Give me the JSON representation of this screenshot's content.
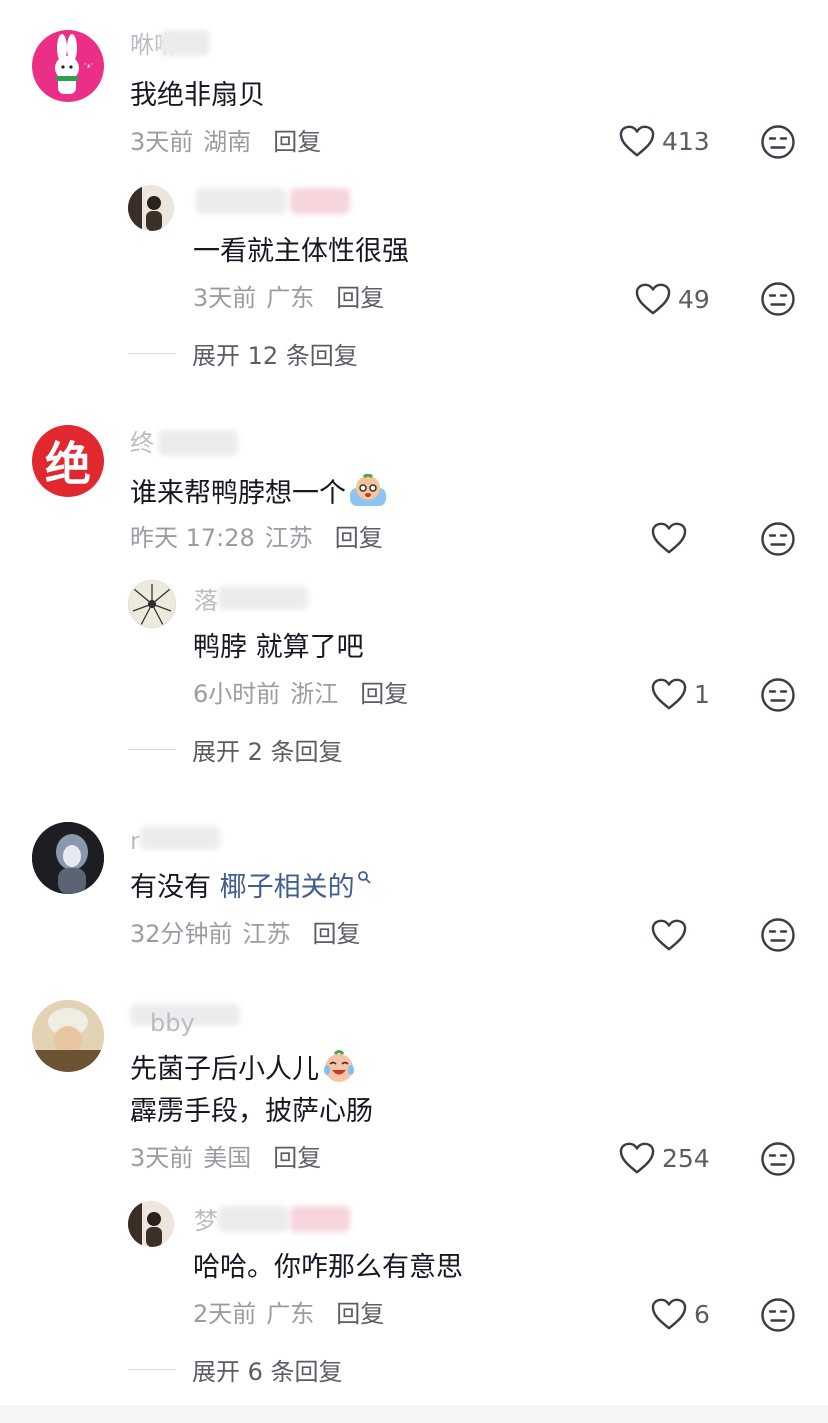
{
  "comments": [
    {
      "name": "咻咻",
      "text": "我绝非扇贝",
      "time": "3天前",
      "location": "湖南",
      "reply_label": "回复",
      "likes": "413",
      "replies": [
        {
          "name": "",
          "text": "一看就主体性很强",
          "time": "3天前",
          "location": "广东",
          "reply_label": "回复",
          "likes": "49"
        }
      ],
      "expand_label": "展开 12 条回复"
    },
    {
      "name": "终",
      "text": "谁来帮鸭脖想一个",
      "time": "昨天 17:28",
      "location": "江苏",
      "reply_label": "回复",
      "likes": "",
      "avatar_char": "绝",
      "replies": [
        {
          "name": "落",
          "text": "鸭脖 就算了吧",
          "time": "6小时前",
          "location": "浙江",
          "reply_label": "回复",
          "likes": "1"
        }
      ],
      "expand_label": "展开 2 条回复"
    },
    {
      "name": "r",
      "text_prefix": "有没有 ",
      "text_link": "椰子相关的",
      "time": "32分钟前",
      "location": "江苏",
      "reply_label": "回复",
      "likes": ""
    },
    {
      "name": "bby",
      "text": "先菌子后小人儿",
      "text_line2": "霹雳手段，披萨心肠",
      "time": "3天前",
      "location": "美国",
      "reply_label": "回复",
      "likes": "254",
      "replies": [
        {
          "name": "梦",
          "text": "哈哈。你咋那么有意思",
          "time": "2天前",
          "location": "广东",
          "reply_label": "回复",
          "likes": "6"
        }
      ],
      "expand_label": "展开 6 条回复"
    }
  ],
  "icons": {
    "like": "heart-outline-icon",
    "dislike": "neutral-face-icon",
    "search": "search-icon"
  },
  "colors": {
    "text": "#161823",
    "meta": "#9a9ca3",
    "link": "#3f5f8f",
    "avatar_red": "#e0282e",
    "avatar_pink": "#ec2f86"
  }
}
